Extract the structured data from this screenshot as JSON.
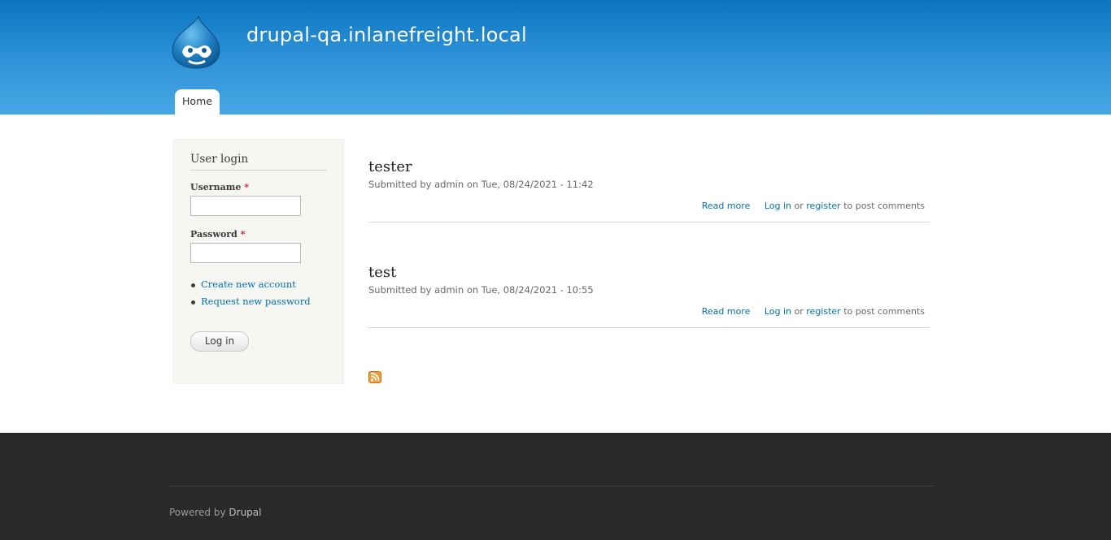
{
  "header": {
    "site_name": "drupal-qa.inlanefreight.local",
    "tabs": [
      {
        "label": "Home"
      }
    ]
  },
  "sidebar": {
    "title": "User login",
    "username_label": "Username",
    "password_label": "Password",
    "required_marker": "*",
    "links": [
      {
        "label": "Create new account"
      },
      {
        "label": "Request new password"
      }
    ],
    "login_button": "Log in"
  },
  "nodes": [
    {
      "title": "tester",
      "submitted_prefix": "Submitted by",
      "author": "admin",
      "date": "on Tue, 08/24/2021 - 11:42",
      "read_more": "Read more",
      "login_link": "Log in",
      "or_text": "or",
      "register_link": "register",
      "post_comments": "to post comments"
    },
    {
      "title": "test",
      "submitted_prefix": "Submitted by",
      "author": "admin",
      "date": "on Tue, 08/24/2021 - 10:55",
      "read_more": "Read more",
      "login_link": "Log in",
      "or_text": "or",
      "register_link": "register",
      "post_comments": "to post comments"
    }
  ],
  "footer": {
    "powered_by": "Powered by",
    "drupal_link": "Drupal"
  },
  "colors": {
    "link": "#0071b3",
    "header_top": "#0a75be",
    "header_bottom": "#48a7e5",
    "footer_bg": "#292929",
    "required": "#e5132e"
  },
  "icons": {
    "logo": "drupal-drop-logo",
    "feed": "rss-feed-icon"
  }
}
